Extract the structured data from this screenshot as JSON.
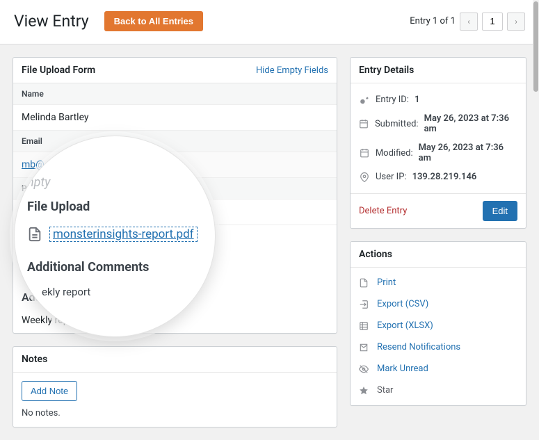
{
  "header": {
    "title": "View Entry",
    "back_button": "Back to All Entries",
    "entry_counter": "Entry 1 of 1",
    "page_input": "1"
  },
  "form": {
    "title": "File Upload Form",
    "hide_link": "Hide Empty Fields",
    "fields": {
      "name_label": "Name",
      "name_value": "Melinda Bartley",
      "email_label": "Email",
      "email_value": "mb@",
      "phone_label": "P",
      "file_upload_heading": "File Upload",
      "file_name": "monsterinsights-report.pdf",
      "comments_heading": "Additional Comments",
      "comments_value": "Weekly report"
    }
  },
  "magnifier": {
    "empty_text": "npty",
    "file_upload_heading": "File Upload",
    "file_name": "monsterinsights-report.pdf",
    "comments_heading": "Additional Comments",
    "comments_frag": "ekly report"
  },
  "notes": {
    "title": "Notes",
    "add_button": "Add Note",
    "empty": "No notes."
  },
  "details": {
    "title": "Entry Details",
    "entry_id_label": "Entry ID: ",
    "entry_id_value": "1",
    "submitted_label": "Submitted: ",
    "submitted_value": "May 26, 2023 at 7:36 am",
    "modified_label": "Modified: ",
    "modified_value": "May 26, 2023 at 7:36 am",
    "user_ip_label": "User IP: ",
    "user_ip_value": "139.28.219.146",
    "delete": "Delete Entry",
    "edit": "Edit"
  },
  "actions": {
    "title": "Actions",
    "print": "Print",
    "export_csv": "Export (CSV)",
    "export_xlsx": "Export (XLSX)",
    "resend": "Resend Notifications",
    "mark_unread": "Mark Unread",
    "star": "Star"
  }
}
